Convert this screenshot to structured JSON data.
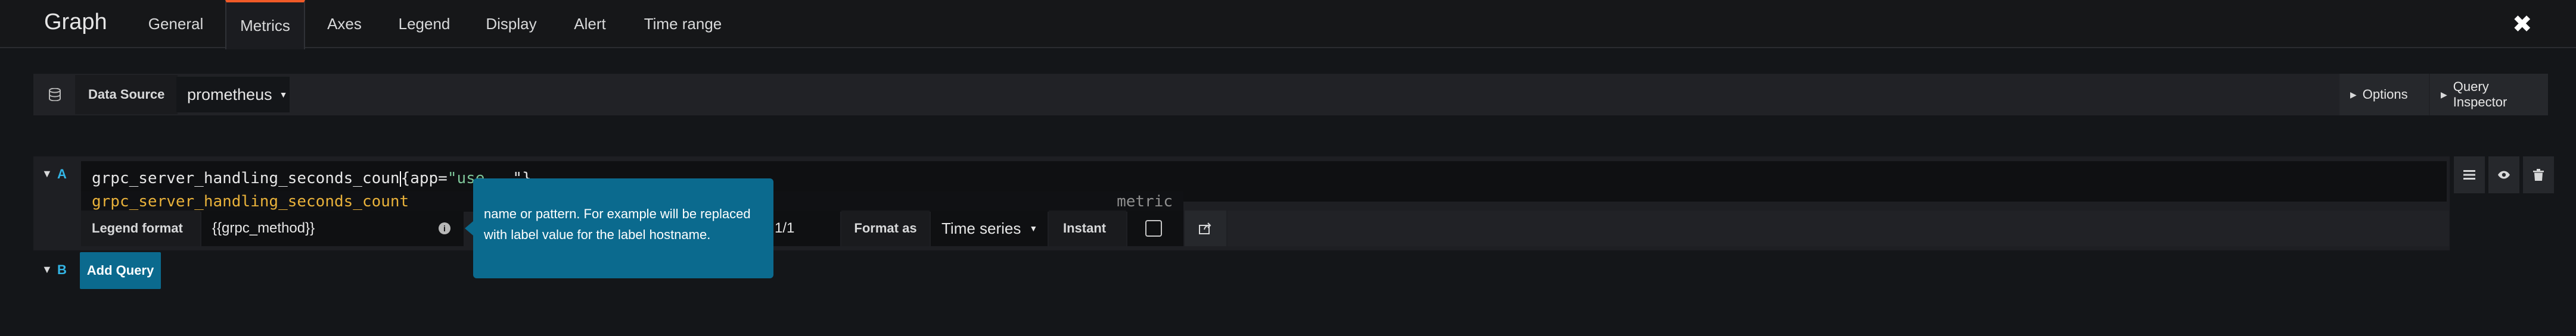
{
  "header": {
    "title": "Graph",
    "tabs": [
      {
        "label": "General"
      },
      {
        "label": "Metrics"
      },
      {
        "label": "Axes"
      },
      {
        "label": "Legend"
      },
      {
        "label": "Display"
      },
      {
        "label": "Alert"
      },
      {
        "label": "Time range"
      }
    ],
    "active_tab": "Metrics",
    "close_glyph": "✖"
  },
  "datasource": {
    "label": "Data Source",
    "selected": "prometheus",
    "options_button": "Options",
    "inspector_button": "Query Inspector"
  },
  "queries": [
    {
      "letter": "A",
      "expr_prefix": "grpc_server_handling_seconds_coun",
      "expr_suffix_code": "{app=",
      "expr_suffix_string": "\"use",
      "expr_tail": "   \"}",
      "autocomplete": {
        "suggestion": "grpc_server_handling_seconds_count",
        "kind": "metric"
      },
      "legend_label": "Legend format",
      "legend_value": "{{grpc_method}}",
      "tooltip_text": "name or pattern. For example will be replaced with label value for the label hostname.",
      "resolution": "1/1",
      "format_label": "Format as",
      "format_value": "Time series",
      "instant_label": "Instant",
      "instant_checked": false
    },
    {
      "letter": "B"
    }
  ],
  "add_query_label": "Add Query",
  "colors": {
    "background": "#141619",
    "accent_tab": "#f05a28",
    "primary_button": "#0b6a8e",
    "query_letter": "#33b5e5",
    "autocomplete_text": "#e8b13a"
  }
}
